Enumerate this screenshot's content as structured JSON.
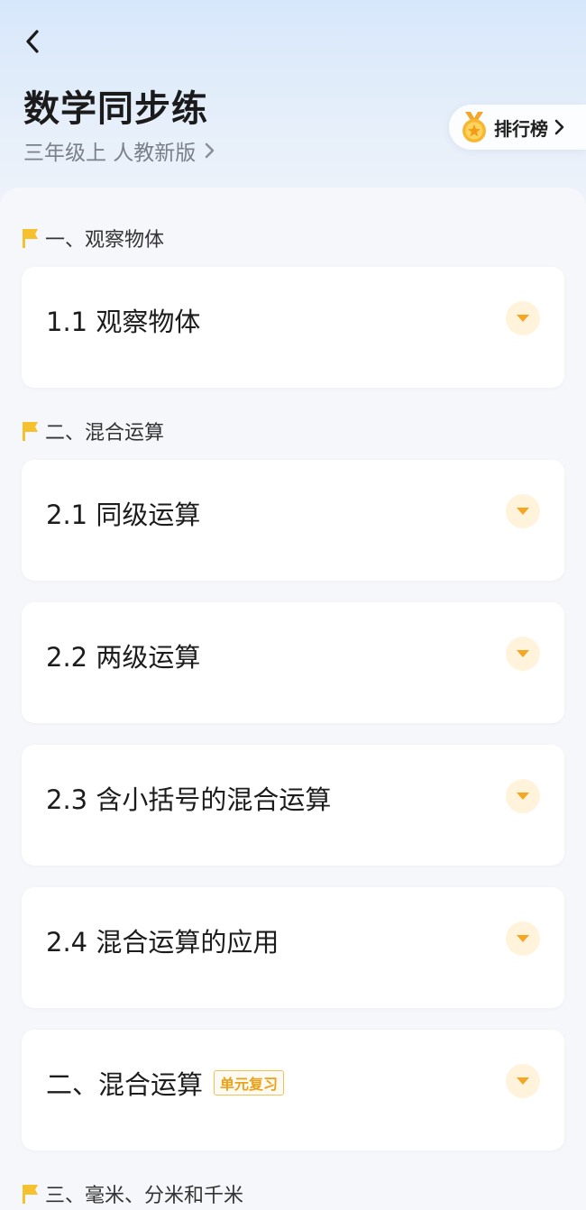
{
  "header": {
    "title": "数学同步练",
    "subtitle": "三年级上 人教新版",
    "ranking_label": "排行榜"
  },
  "sections": [
    {
      "title": "一、观察物体"
    },
    {
      "title": "二、混合运算"
    },
    {
      "title": "三、毫米、分米和千米"
    }
  ],
  "lessons": [
    {
      "title": "1.1 观察物体"
    },
    {
      "title": "2.1 同级运算"
    },
    {
      "title": "2.2 两级运算"
    },
    {
      "title": "2.3 含小括号的混合运算"
    },
    {
      "title": "2.4 混合运算的应用"
    },
    {
      "title": "二、混合运算",
      "badge": "单元复习"
    }
  ],
  "colors": {
    "accent_orange": "#f5a623",
    "flag_yellow": "#f6c12f",
    "badge_orange": "#e8a21c"
  },
  "icons": [
    "back-arrow-icon",
    "chevron-right-icon",
    "medal-icon",
    "flag-icon",
    "triangle-down-icon"
  ]
}
